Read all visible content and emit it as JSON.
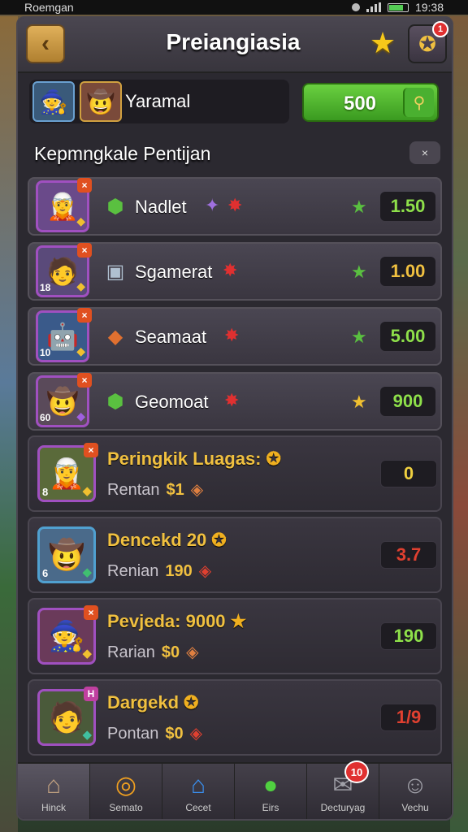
{
  "status_bar": {
    "left_text": "Roemgan",
    "time": "19:38"
  },
  "header": {
    "title": "Preiangiasia",
    "back_label": "‹",
    "notification_count": "1"
  },
  "player": {
    "name": "Yaramal",
    "coins": "500"
  },
  "section": {
    "title": "Kepmngkale Pentijan",
    "close_label": "×"
  },
  "rows": [
    {
      "name": "Nadlet",
      "value": "1.50",
      "value_color": "#8ee04a",
      "level": "",
      "item_icon": "green-gem-icon",
      "star_color": "#5ac040"
    },
    {
      "name": "Sgamerat",
      "value": "1.00",
      "value_color": "#f0c040",
      "level": "18",
      "item_icon": "cube-icon",
      "star_color": "#5ac040"
    },
    {
      "name": "Seamaat",
      "value": "5.00",
      "value_color": "#8ee04a",
      "level": "10",
      "item_icon": "orange-gem-icon",
      "star_color": "#5ac040"
    },
    {
      "name": "Geomoat",
      "value": "900",
      "value_color": "#8ee04a",
      "level": "60",
      "item_icon": "green-gem-icon",
      "star_color": "#f0c030"
    }
  ],
  "cards": [
    {
      "title": "Peringkik Luagas:",
      "sub_label": "Rentan",
      "sub_value": "$1",
      "value": "0",
      "value_color": "#f0d040",
      "level": "8"
    },
    {
      "title": "Dencekd 20",
      "sub_label": "Renian",
      "sub_value": "190",
      "value": "3.7",
      "value_color": "#e04030",
      "level": "6"
    },
    {
      "title": "Pevjeda: 9000",
      "sub_label": "Rarian",
      "sub_value": "$0",
      "value": "190",
      "value_color": "#8ee04a",
      "level": ""
    },
    {
      "title": "Dargekd",
      "sub_label": "Pontan",
      "sub_value": "$0",
      "value": "1/9",
      "value_color": "#e04030",
      "level": ""
    }
  ],
  "nav": [
    {
      "label": "Hinck",
      "icon": "home-icon"
    },
    {
      "label": "Semato",
      "icon": "swirl-icon"
    },
    {
      "label": "Cecet",
      "icon": "house-icon"
    },
    {
      "label": "Eirs",
      "icon": "orb-icon"
    },
    {
      "label": "Decturyag",
      "icon": "chat-icon",
      "badge": "10"
    },
    {
      "label": "Vechu",
      "icon": "profile-icon"
    }
  ]
}
